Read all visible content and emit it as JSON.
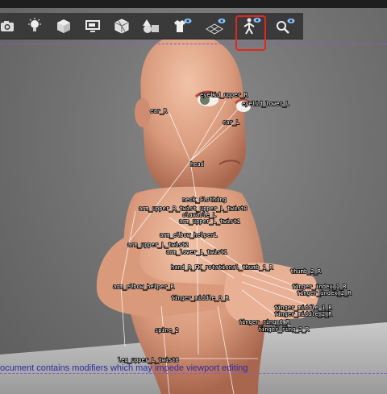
{
  "toolbar": {
    "buttons": [
      {
        "icon": "camera-icon"
      },
      {
        "icon": "light-icon"
      },
      {
        "icon": "cube-icon"
      },
      {
        "icon": "display-icon"
      },
      {
        "icon": "wireframe-cube-icon"
      },
      {
        "icon": "shapes-icon"
      },
      {
        "icon": "shirt-visibility-icon"
      },
      {
        "icon": "grid-visibility-icon"
      },
      {
        "icon": "skeleton-visibility-icon"
      },
      {
        "icon": "search-visibility-icon"
      }
    ],
    "highlight_color": "#e4251f"
  },
  "bones": {
    "eyelid_upper_r": "eyelid_upper_R",
    "eyelid_lower_l": "eyelid_lower_L",
    "ear_r": "ear_R",
    "ear_l": "ear_L",
    "head": "head",
    "neck_clothing": "neck_Clothing",
    "arm_upper_r_twist": "arm_upper_R_twist_upper_L_twist0",
    "clavicle_l": "clavicle_L",
    "arm_upper_l_twist1": "arm_upper_L_twist1",
    "arm_elbow_helper": "arm_elbow_helperL",
    "arm_upper_l_twist2": "arm_upper_L_twist2",
    "arm_lower_l_twist1": "arm_lower_L_twist1",
    "hand_r": "hand_R_FK_rotational_thumb_1_R",
    "thumb_2_r": "thumb_2_R",
    "arm_elbow_helper_r": "arm_elbow_helper_R",
    "finger_index_1_r": "finger_index_1_R",
    "finger_index_2_r": "finger_index_2_R",
    "finger_middle_0_r": "finger_middle_0_R",
    "finger_middle_1_r": "finger_middle_1_R",
    "finger_middle_2_r": "finger_middle_2_R",
    "finger_ring_0_r": "finger_ring_0_R",
    "finger_ring_2_r": "finger_ring_2_R",
    "spine_2": "spine_2",
    "leg_upper_l_twist0": "leg_upper_L_twist0"
  },
  "status": {
    "message": "ocument contains modifiers which may impede viewport editing",
    "color": "#2a2aa8"
  }
}
